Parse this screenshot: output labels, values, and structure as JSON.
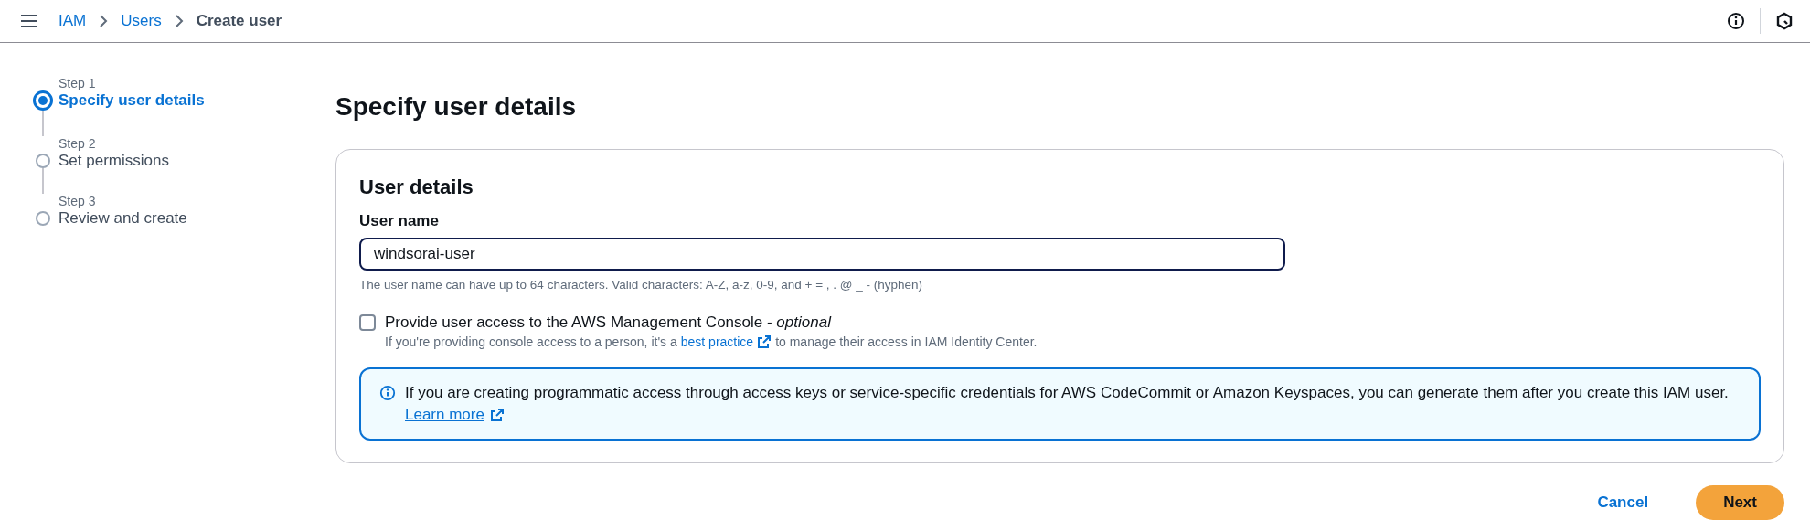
{
  "breadcrumbs": [
    {
      "label": "IAM",
      "kind": "link"
    },
    {
      "label": "Users",
      "kind": "link"
    },
    {
      "label": "Create user",
      "kind": "current"
    }
  ],
  "steps": [
    {
      "step": "Step 1",
      "label": "Specify user details",
      "selected": true
    },
    {
      "step": "Step 2",
      "label": "Set permissions",
      "selected": false
    },
    {
      "step": "Step 3",
      "label": "Review and create",
      "selected": false
    }
  ],
  "page_title": "Specify user details",
  "card": {
    "title": "User details",
    "user_name": {
      "label": "User name",
      "value": "windsorai-user",
      "hint": "The user name can have up to 64 characters. Valid characters: A-Z, a-z, 0-9, and + = , . @ _ - (hyphen)"
    },
    "console_access": {
      "label": "Provide user access to the AWS Management Console - *optional*",
      "checked": false,
      "description_before": "If you're providing console access to a person, it's a",
      "link": "best practice",
      "description_after": "to manage their access in IAM Identity Center."
    },
    "info": {
      "text": "If you are creating programmatic access through access keys or service-specific credentials for AWS CodeCommit or Amazon Keyspaces, you can generate them after you create this IAM user.",
      "link": "Learn more"
    }
  },
  "buttons": [
    {
      "label": "Cancel",
      "kind": "secondary"
    },
    {
      "label": "Next",
      "kind": "primary"
    }
  ]
}
